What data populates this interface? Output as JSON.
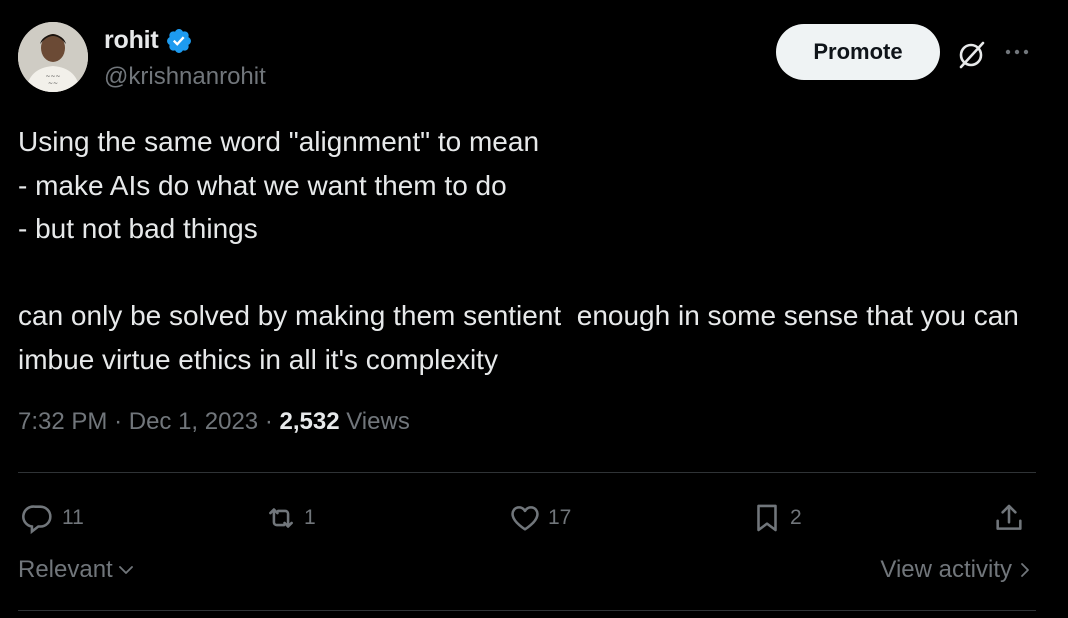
{
  "author": {
    "name": "rohit",
    "handle": "@krishnanrohit",
    "verified": true,
    "avatar_icon": "avatar-photo"
  },
  "header": {
    "promote_label": "Promote",
    "grok_icon": "grok-icon",
    "more_icon": "more-icon"
  },
  "tweet": {
    "text": "Using the same word \"alignment\" to mean\n- make AIs do what we want them to do\n- but not bad things\n\ncan only be solved by making them sentient  enough in some sense that you can imbue virtue ethics in all it's complexity",
    "time": "7:32 PM",
    "date": "Dec 1, 2023",
    "views_count": "2,532",
    "views_label": "Views"
  },
  "actions": {
    "replies": "11",
    "reposts": "1",
    "likes": "17",
    "bookmarks": "2"
  },
  "footer": {
    "sort_label": "Relevant",
    "view_activity_label": "View activity"
  },
  "colors": {
    "background": "#000000",
    "text_primary": "#e7e9ea",
    "text_secondary": "#71767b",
    "verified_badge": "#1d9bf0",
    "divider": "#2f3336",
    "promote_bg": "#eff3f4"
  }
}
